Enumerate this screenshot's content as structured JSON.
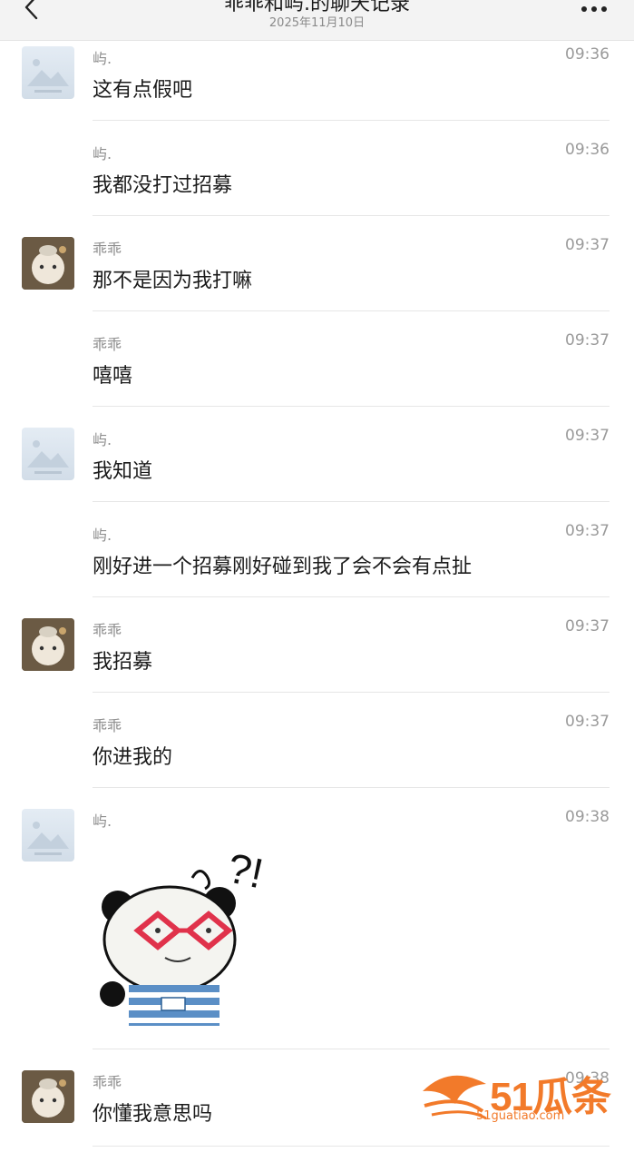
{
  "header": {
    "title": "乖乖和屿.的聊天记录",
    "subtitle": "2025年11月10日"
  },
  "messages": [
    {
      "name": "屿.",
      "time": "09:36",
      "text": "这有点假吧"
    },
    {
      "name": "屿.",
      "time": "09:36",
      "text": "我都没打过招募"
    },
    {
      "name": "乖乖",
      "time": "09:37",
      "text": "那不是因为我打嘛"
    },
    {
      "name": "乖乖",
      "time": "09:37",
      "text": "嘻嘻"
    },
    {
      "name": "屿.",
      "time": "09:37",
      "text": "我知道"
    },
    {
      "name": "屿.",
      "time": "09:37",
      "text": "刚好进一个招募刚好碰到我了会不会有点扯"
    },
    {
      "name": "乖乖",
      "time": "09:37",
      "text": "我招募"
    },
    {
      "name": "乖乖",
      "time": "09:37",
      "text": "你进我的"
    },
    {
      "name": "屿.",
      "time": "09:38",
      "text": ""
    },
    {
      "name": "乖乖",
      "time": "09:38",
      "text": "你懂我意思吗"
    }
  ],
  "watermark": {
    "brand": "51瓜条",
    "url": "51guatiao.com"
  },
  "icons": {
    "back": "chevron-left-icon",
    "more": "more-dots-icon"
  }
}
